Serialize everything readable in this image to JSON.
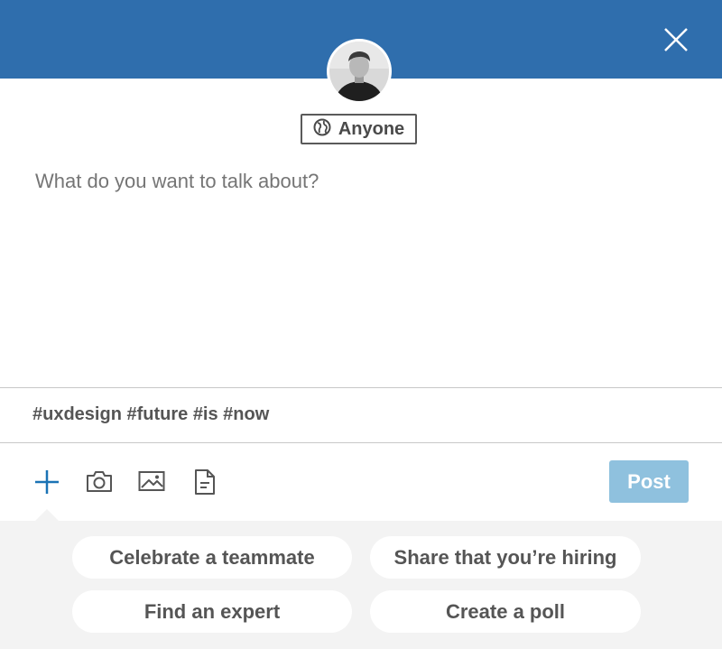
{
  "header": {
    "color": "#2f6ead",
    "close_icon": "close-icon"
  },
  "avatar": {
    "icon": "user-avatar"
  },
  "visibility": {
    "icon": "globe-icon",
    "label": "Anyone"
  },
  "composer": {
    "placeholder": "What do you want to talk about?",
    "value": ""
  },
  "hashtags": {
    "text": "#uxdesign #future #is #now"
  },
  "toolbar": {
    "icons": [
      "plus-icon",
      "camera-icon",
      "image-icon",
      "document-icon"
    ],
    "accent": "#1a73b5",
    "post_label": "Post",
    "post_color": "#8fc1de"
  },
  "suggestions": [
    {
      "label": "Celebrate a teammate"
    },
    {
      "label": "Share that you’re hiring"
    },
    {
      "label": "Find an expert"
    },
    {
      "label": "Create a poll"
    }
  ]
}
